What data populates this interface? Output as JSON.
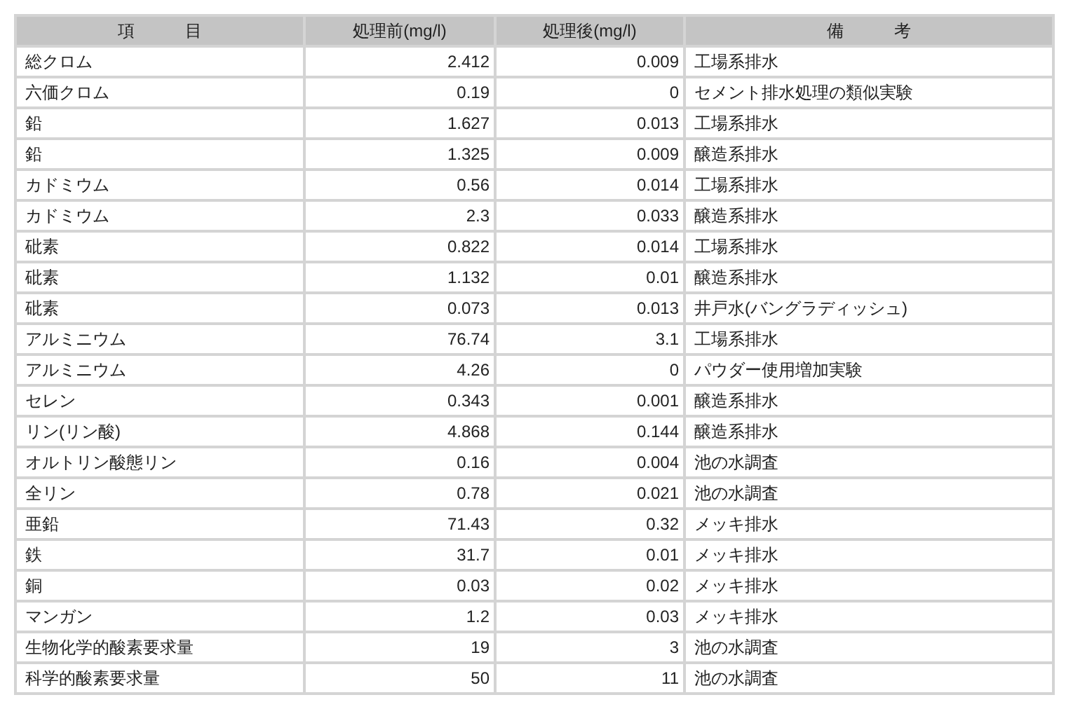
{
  "table": {
    "columns": [
      "項　　　目",
      "処理前(mg/l)",
      "処理後(mg/l)",
      "備　　　考"
    ],
    "rows": [
      [
        "総クロム",
        "2.412",
        "0.009",
        "工場系排水"
      ],
      [
        "六価クロム",
        "0.19",
        "0",
        "セメント排水処理の類似実験"
      ],
      [
        "鉛",
        "1.627",
        "0.013",
        "工場系排水"
      ],
      [
        "鉛",
        "1.325",
        "0.009",
        "醸造系排水"
      ],
      [
        "カドミウム",
        "0.56",
        "0.014",
        "工場系排水"
      ],
      [
        "カドミウム",
        "2.3",
        "0.033",
        "醸造系排水"
      ],
      [
        "砒素",
        "0.822",
        "0.014",
        "工場系排水"
      ],
      [
        "砒素",
        "1.132",
        "0.01",
        "醸造系排水"
      ],
      [
        "砒素",
        "0.073",
        "0.013",
        "井戸水(バングラディッシュ)"
      ],
      [
        "アルミニウム",
        "76.74",
        "3.1",
        "工場系排水"
      ],
      [
        "アルミニウム",
        "4.26",
        "0",
        "パウダー使用増加実験"
      ],
      [
        "セレン",
        "0.343",
        "0.001",
        "醸造系排水"
      ],
      [
        "リン(リン酸)",
        "4.868",
        "0.144",
        "醸造系排水"
      ],
      [
        "オルトリン酸態リン",
        "0.16",
        "0.004",
        "池の水調査"
      ],
      [
        "全リン",
        "0.78",
        "0.021",
        "池の水調査"
      ],
      [
        "亜鉛",
        "71.43",
        "0.32",
        "メッキ排水"
      ],
      [
        "鉄",
        "31.7",
        "0.01",
        "メッキ排水"
      ],
      [
        "銅",
        "0.03",
        "0.02",
        "メッキ排水"
      ],
      [
        "マンガン",
        "1.2",
        "0.03",
        "メッキ排水"
      ],
      [
        "生物化学的酸素要求量",
        "19",
        "3",
        "池の水調査"
      ],
      [
        "科学的酸素要求量",
        "50",
        "11",
        "池の水調査"
      ]
    ]
  }
}
